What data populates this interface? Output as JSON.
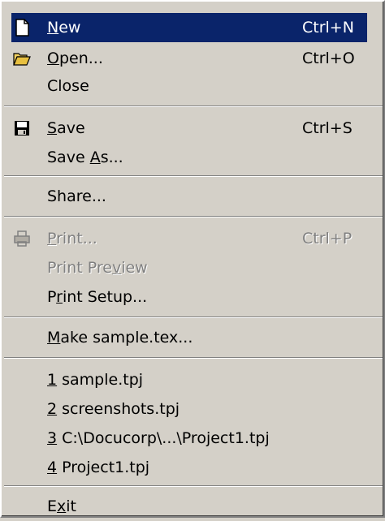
{
  "menu": {
    "new": {
      "pre": "",
      "u": "N",
      "post": "ew",
      "shortcut": "Ctrl+N",
      "icon": "new-document-icon"
    },
    "open": {
      "pre": "",
      "u": "O",
      "post": "pen...",
      "shortcut": "Ctrl+O",
      "icon": "open-folder-icon"
    },
    "close": {
      "label": "Close"
    },
    "save": {
      "pre": "",
      "u": "S",
      "post": "ave",
      "shortcut": "Ctrl+S",
      "icon": "floppy-disk-icon"
    },
    "save_as": {
      "pre": "Save ",
      "u": "A",
      "post": "s..."
    },
    "share": {
      "label": "Share..."
    },
    "print": {
      "pre": "",
      "u": "P",
      "post": "rint...",
      "shortcut": "Ctrl+P",
      "icon": "printer-icon",
      "disabled": true
    },
    "print_preview": {
      "pre": "Print Pre",
      "u": "v",
      "post": "iew",
      "disabled": true
    },
    "print_setup": {
      "pre": "P",
      "u": "r",
      "post": "int Setup..."
    },
    "make_sample": {
      "pre": "",
      "u": "M",
      "post": "ake sample.tex..."
    },
    "recent": [
      {
        "num": "1",
        "name": " sample.tpj"
      },
      {
        "num": "2",
        "name": " screenshots.tpj"
      },
      {
        "num": "3",
        "name": " C:\\Docucorp\\...\\Project1.tpj"
      },
      {
        "num": "4",
        "name": " Project1.tpj"
      }
    ],
    "exit": {
      "pre": "E",
      "u": "x",
      "post": "it"
    }
  },
  "colors": {
    "menu_bg": "#d4d0c8",
    "highlight": "#0a246a",
    "disabled": "#808080"
  }
}
